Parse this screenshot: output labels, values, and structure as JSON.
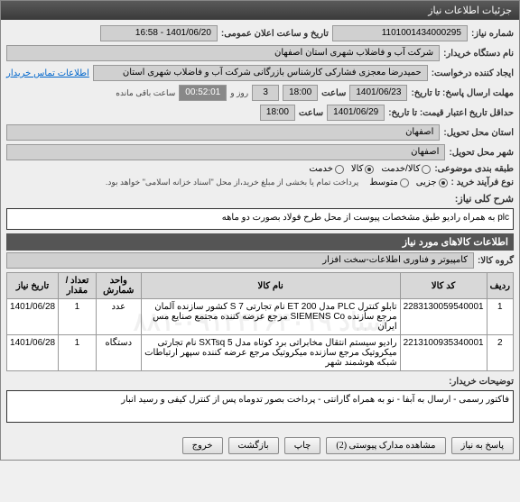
{
  "window": {
    "title": "جزئیات اطلاعات نیاز"
  },
  "header": {
    "need_number_label": "شماره نیاز:",
    "need_number": "1101001434000295",
    "announce_label": "تاریخ و ساعت اعلان عمومی:",
    "announce_value": "1401/06/20 - 16:58",
    "buyer_org_label": "نام دستگاه خریدار:",
    "buyer_org": "شرکت آب و فاضلاب شهری استان اصفهان",
    "requester_label": "ایجاد کننده درخواست:",
    "requester": "حمیدرضا معجزی فشارکی کارشناس بازرگانی شرکت آب و فاضلاب شهری استان",
    "contact_link": "اطلاعات تماس خریدار",
    "deadline_label": "مهلت ارسال پاسخ: تا تاریخ:",
    "deadline_date": "1401/06/23",
    "time_label": "ساعت",
    "deadline_time": "18:00",
    "days_left": "3",
    "days_and": "روز و",
    "countdown": "00:52:01",
    "remaining": "ساعت باقی مانده",
    "validity_label": "حداقل تاریخ اعتبار قیمت: تا تاریخ:",
    "validity_date": "1401/06/29",
    "validity_time": "18:00",
    "delivery_city_label": "استان محل تحویل:",
    "delivery_city": "اصفهان",
    "delivery_town_label": "شهر محل تحویل:",
    "delivery_town": "اصفهان",
    "category_label": "طبقه بندی موضوعی:",
    "cat_service": "کالا/خدمت",
    "cat_goods": "کالا",
    "cat_serv": "خدمت",
    "process_label": "نوع فرآیند خرید :",
    "proc_partial": "جزیی",
    "proc_medium": "متوسط",
    "note": "پرداخت تمام یا بخشی از مبلغ خرید،از محل \"اسناد خزانه اسلامی\" خواهد بود."
  },
  "need": {
    "title_label": "شرح کلی نیاز:",
    "title": "plc  به همراه رادیو طبق مشخصات پیوست از محل طرح فولاد بصورت دو ماهه"
  },
  "items": {
    "section_title": "اطلاعات کالاهای مورد نیاز",
    "group_label": "گروه کالا:",
    "group": "کامپیوتر و فناوری اطلاعات-سخت افزار",
    "headers": {
      "row": "ردیف",
      "code": "کد کالا",
      "name": "نام کالا",
      "unit": "واحد شمارش",
      "qty": "تعداد / مقدار",
      "date": "تاریخ نیاز"
    },
    "rows": [
      {
        "idx": "1",
        "code": "2283130059540001",
        "name": "تابلو کنترل PLC مدل ET 200 نام تجارتی S 7 کشور سازنده آلمان مرجع سازنده SIEMENS Co مرجع عرضه کننده مجتمع صنایع مس ایران",
        "unit": "عدد",
        "qty": "1",
        "date": "1401/06/28"
      },
      {
        "idx": "2",
        "code": "2213100935340001",
        "name": "رادیو سیستم انتقال مخابراتی برد کوتاه مدل SXTsq 5 نام تجارتی میکروتیک مرجع سازنده میکروتیک مرجع عرضه کننده سپهر ارتباطات شبکه هوشمند شهر",
        "unit": "دستگاه",
        "qty": "1",
        "date": "1401/06/28"
      }
    ]
  },
  "buyer_notes": {
    "label": "توضیحات خریدار:",
    "text": "فاکتور رسمی - ارسال به آبفا - نو به همراه گارانتی - پرداخت بصور تدوماه پس از کنترل کیفی و رسید انبار"
  },
  "buttons": {
    "respond": "پاسخ به نیاز",
    "defects": "مشاهده مدارک پیوستی (2)",
    "print": "چاپ",
    "back": "بازگشت",
    "exit": "خروج"
  },
  "watermark": "ستاد ۰۹۱۲۴۳۶۴۰۱۹-۸۸۱"
}
